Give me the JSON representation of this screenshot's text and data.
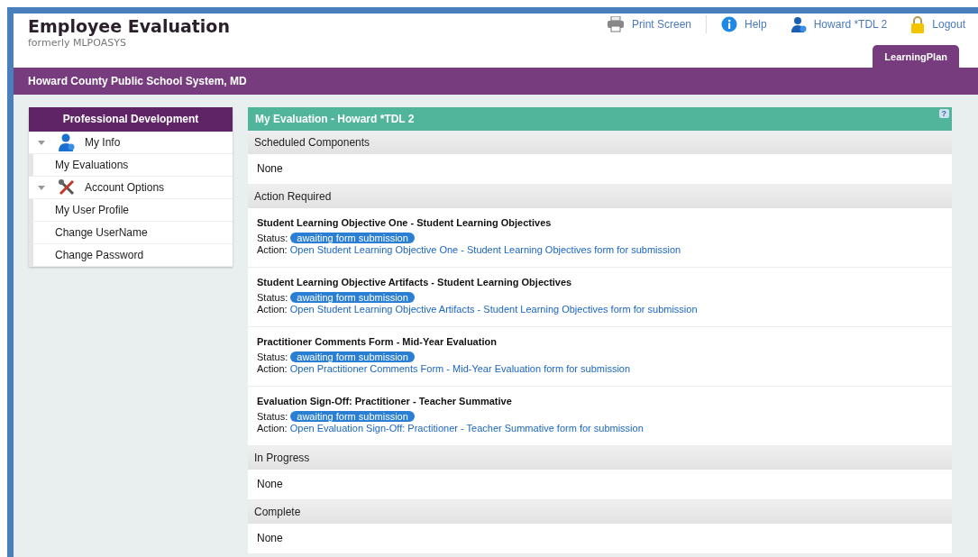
{
  "app": {
    "title": "Employee Evaluation",
    "subtitle": "formerly MLPOASYS"
  },
  "top_links": [
    {
      "label": "Print Screen"
    },
    {
      "label": "Help"
    },
    {
      "label": "Howard *TDL 2"
    },
    {
      "label": "Logout"
    }
  ],
  "tabs": [
    {
      "label": "LearningPlan",
      "selected": true
    }
  ],
  "org_bar": {
    "title": "Howard County Public School System, MD"
  },
  "sidebar": {
    "title": "Professional Development",
    "groups": [
      {
        "label": "My Info",
        "expanded": true,
        "children": [
          {
            "label": "My Evaluations"
          }
        ]
      },
      {
        "label": "Account Options",
        "expanded": true,
        "children": [
          {
            "label": "My User Profile"
          },
          {
            "label": "Change UserName"
          },
          {
            "label": "Change Password"
          }
        ]
      }
    ]
  },
  "panel": {
    "title": "My Evaluation - Howard *TDL 2",
    "help": "?",
    "sections": [
      {
        "title": "Scheduled Components",
        "none_text": "None"
      },
      {
        "title": "Action Required",
        "items": [
          {
            "title": "Student Learning Objective One - Student Learning Objectives",
            "status_label": "Status:",
            "status": "awaiting form submission",
            "action_label": "Action:",
            "action": "Open Student Learning Objective One - Student Learning Objectives form for submission"
          },
          {
            "title": "Student Learning Objective Artifacts - Student Learning Objectives",
            "status_label": "Status:",
            "status": "awaiting form submission",
            "action_label": "Action:",
            "action": "Open Student Learning Objective Artifacts - Student Learning Objectives form for submission"
          },
          {
            "title": "Practitioner Comments Form - Mid-Year Evaluation",
            "status_label": "Status:",
            "status": "awaiting form submission",
            "action_label": "Action:",
            "action": "Open Practitioner Comments Form - Mid-Year Evaluation form for submission"
          },
          {
            "title": "Evaluation Sign-Off: Practitioner - Teacher Summative",
            "status_label": "Status:",
            "status": "awaiting form submission",
            "action_label": "Action:",
            "action": "Open Evaluation Sign-Off: Practitioner - Teacher Summative form for submission"
          }
        ]
      },
      {
        "title": "In Progress",
        "none_text": "None"
      },
      {
        "title": "Complete",
        "none_text": "None"
      }
    ]
  }
}
